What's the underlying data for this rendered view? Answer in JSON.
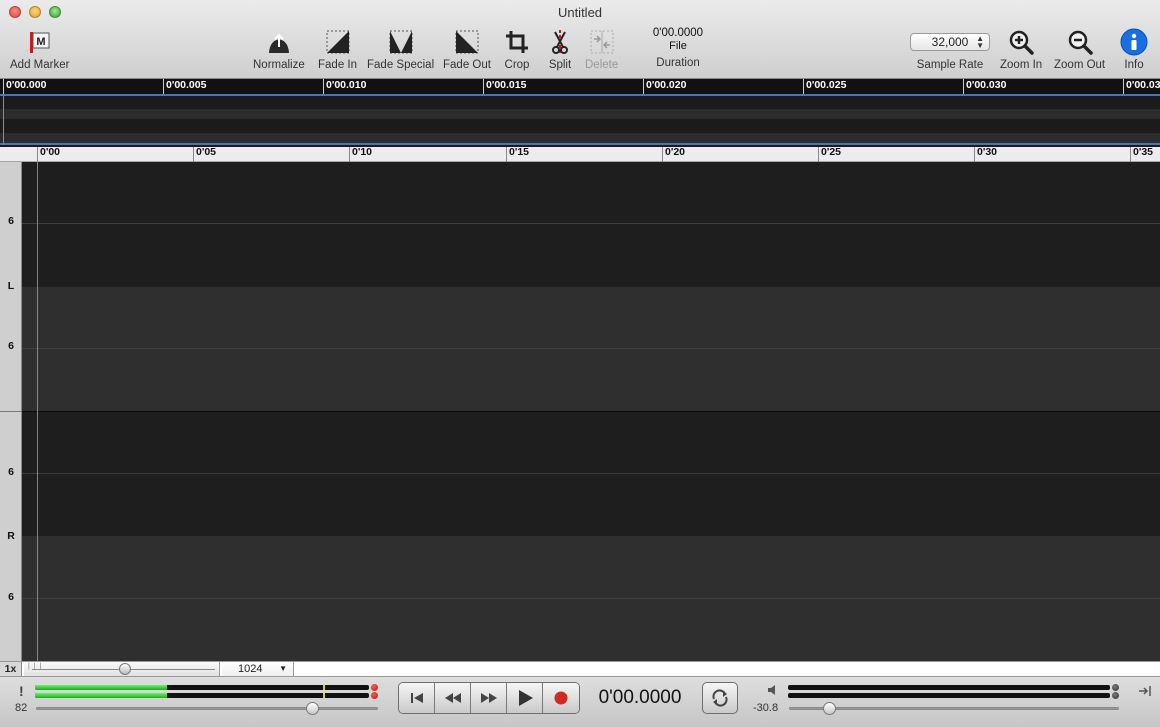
{
  "window": {
    "title": "Untitled"
  },
  "toolbar": {
    "add_marker": "Add Marker",
    "marker_glyph": "M",
    "normalize": "Normalize",
    "fade_in": "Fade In",
    "fade_special": "Fade Special",
    "fade_out": "Fade Out",
    "crop": "Crop",
    "split": "Split",
    "delete": "Delete",
    "duration_time": "0'00.0000",
    "duration_source": "File",
    "duration_label": "Duration",
    "sample_rate_value": "32,000",
    "sample_rate_label": "Sample Rate",
    "zoom_in": "Zoom In",
    "zoom_out": "Zoom Out",
    "info": "Info"
  },
  "overview": {
    "ticks": [
      "0'00.000",
      "0'00.005",
      "0'00.010",
      "0'00.015",
      "0'00.020",
      "0'00.025",
      "0'00.030",
      "0'00.03"
    ]
  },
  "timeline": {
    "ticks": [
      "0'00",
      "0'05",
      "0'10",
      "0'15",
      "0'20",
      "0'25",
      "0'30",
      "0'35"
    ]
  },
  "channels": {
    "left_label": "L",
    "right_label": "R",
    "scale_label": "6"
  },
  "zoom": {
    "level": "1x",
    "fft_size": "1024"
  },
  "transport": {
    "timecode": "0'00.0000",
    "input_level": "82",
    "output_level": "-30.8",
    "warning_glyph": "!"
  },
  "colors": {
    "playhead": "#2fbf3c",
    "overview_line": "#4d72b7",
    "meter_green": "#19b019",
    "clip_red": "#e03a30",
    "info_blue": "#1a6fe0"
  }
}
